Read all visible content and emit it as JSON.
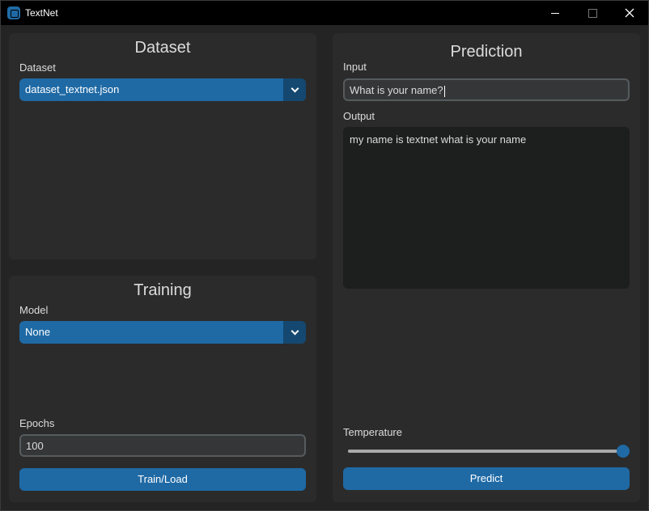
{
  "window": {
    "title": "TextNet"
  },
  "dataset_panel": {
    "title": "Dataset",
    "dataset_label": "Dataset",
    "dataset_selected": "dataset_textnet.json"
  },
  "training_panel": {
    "title": "Training",
    "model_label": "Model",
    "model_selected": "None",
    "epochs_label": "Epochs",
    "epochs_value": "100",
    "train_button": "Train/Load"
  },
  "prediction_panel": {
    "title": "Prediction",
    "input_label": "Input",
    "input_value": "What is your name?",
    "output_label": "Output",
    "output_value": "my name is textnet what is your name",
    "temperature_label": "Temperature",
    "temperature_value": 1.0,
    "predict_button": "Predict"
  },
  "colors": {
    "accent": "#1f6aa5",
    "accent_dark": "#144870",
    "panel_bg": "#2b2b2b",
    "window_bg": "#242424"
  }
}
